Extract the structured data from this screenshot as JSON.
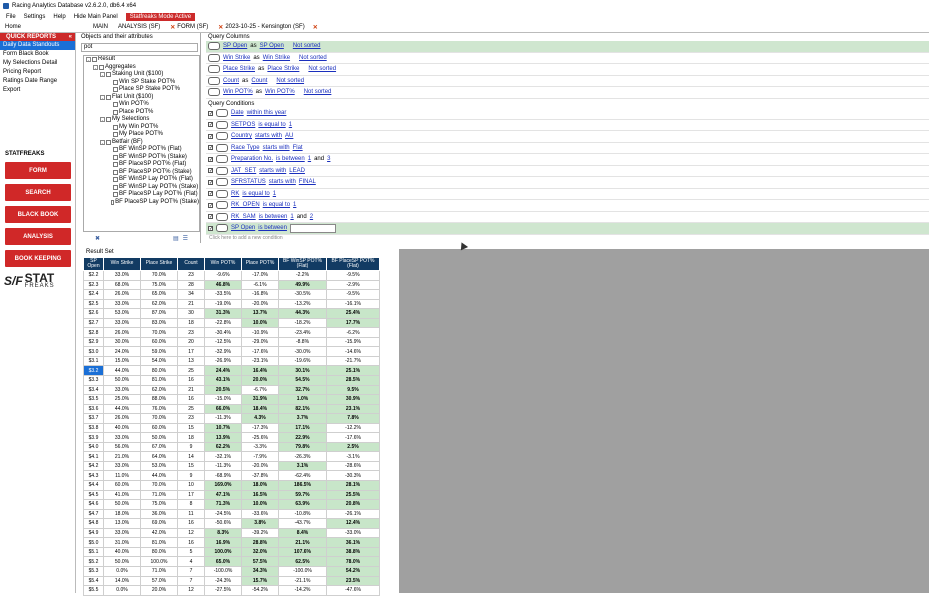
{
  "window": {
    "title": "Racing Analytics Database v2.6.2.0, db6.4 x64"
  },
  "menu": {
    "items": [
      "File",
      "Settings",
      "Help",
      "Hide Main Panel"
    ],
    "mode_badge": "Statfreaks Mode Active"
  },
  "tabs": {
    "home": "Home",
    "main": "MAIN",
    "analysis": "ANALYSIS (SF)",
    "form": "FORM (SF)",
    "meeting": "2023-10-25 - Kensington (SF)"
  },
  "sidebar": {
    "quick_reports_title": "QUICK REPORTS",
    "quick_reports": [
      "Daily Data Standouts",
      "Form Black Book",
      "My Selections Detail",
      "Pricing Report",
      "Ratings Date Range Export"
    ],
    "statfreaks_title": "STATFREAKS",
    "buttons": [
      "FORM",
      "SEARCH",
      "BLACK BOOK",
      "ANALYSIS",
      "BOOK KEEPING"
    ],
    "logo_mark": "S/F",
    "logo_word": "STAT",
    "logo_sub": "FREAKS"
  },
  "objects": {
    "title": "Objects and their attributes",
    "search_value": "pot",
    "tree": [
      {
        "label": "Result",
        "level": 0,
        "expander": "-"
      },
      {
        "label": "Aggregates",
        "level": 1,
        "expander": "-"
      },
      {
        "label": "Staking Unit ($100)",
        "level": 2,
        "expander": "-"
      },
      {
        "label": "Win SP Stake POT%",
        "level": 3,
        "expander": ""
      },
      {
        "label": "Place SP Stake POT%",
        "level": 3,
        "expander": ""
      },
      {
        "label": "Flat Unit ($100)",
        "level": 2,
        "expander": "-"
      },
      {
        "label": "Win POT%",
        "level": 3,
        "expander": ""
      },
      {
        "label": "Place POT%",
        "level": 3,
        "expander": ""
      },
      {
        "label": "My Selections",
        "level": 2,
        "expander": "-"
      },
      {
        "label": "My Win POT%",
        "level": 3,
        "expander": ""
      },
      {
        "label": "My Place POT%",
        "level": 3,
        "expander": ""
      },
      {
        "label": "Betfair (BF)",
        "level": 2,
        "expander": "-"
      },
      {
        "label": "BF WinSP POT% (Flat)",
        "level": 3,
        "expander": ""
      },
      {
        "label": "BF WinSP POT% (Stake)",
        "level": 3,
        "expander": ""
      },
      {
        "label": "BF PlaceSP POT% (Flat)",
        "level": 3,
        "expander": ""
      },
      {
        "label": "BF PlaceSP POT% (Stake)",
        "level": 3,
        "expander": ""
      },
      {
        "label": "BF WinSP Lay POT% (Flat)",
        "level": 3,
        "expander": ""
      },
      {
        "label": "BF WinSP Lay POT% (Stake)",
        "level": 3,
        "expander": ""
      },
      {
        "label": "BF PlaceSP Lay POT% (Flat)",
        "level": 3,
        "expander": ""
      },
      {
        "label": "BF PlaceSP Lay POT% (Stake)",
        "level": 3,
        "expander": ""
      }
    ]
  },
  "query_columns": {
    "title": "Query Columns",
    "rows": [
      {
        "field": "SP Open",
        "as": "as",
        "alias": "SP Open",
        "sort": "Not sorted",
        "highlight": true
      },
      {
        "field": "Win Strike",
        "as": "as",
        "alias": "Win Strike",
        "sort": "Not sorted",
        "highlight": false
      },
      {
        "field": "Place Strike",
        "as": "as",
        "alias": "Place Strike",
        "sort": "Not sorted",
        "highlight": false
      },
      {
        "field": "Count",
        "as": "as",
        "alias": "Count",
        "sort": "Not sorted",
        "highlight": false
      },
      {
        "field": "Win POT%",
        "as": "as",
        "alias": "Win POT%",
        "sort": "Not sorted",
        "highlight": false
      }
    ]
  },
  "query_conditions": {
    "title": "Query Conditions",
    "rows": [
      {
        "field": "Date",
        "op": "within this year",
        "v1": "",
        "and": "",
        "v2": "",
        "highlight": false
      },
      {
        "field": "SETPOS",
        "op": "is equal to",
        "v1": "1",
        "and": "",
        "v2": "",
        "highlight": false
      },
      {
        "field": "Country",
        "op": "starts with",
        "v1": "AU",
        "and": "",
        "v2": "",
        "highlight": false
      },
      {
        "field": "Race Type",
        "op": "starts with",
        "v1": "Flat",
        "and": "",
        "v2": "",
        "highlight": false
      },
      {
        "field": "Preparation No.",
        "op": "is between",
        "v1": "1",
        "and": "and",
        "v2": "3",
        "highlight": false
      },
      {
        "field": "JAT_SET",
        "op": "starts with",
        "v1": "LEAD",
        "and": "",
        "v2": "",
        "highlight": false
      },
      {
        "field": "SFRSTATUS",
        "op": "starts with",
        "v1": "FINAL",
        "and": "",
        "v2": "",
        "highlight": false
      },
      {
        "field": "RK",
        "op": "is equal to",
        "v1": "1",
        "and": "",
        "v2": "",
        "highlight": false
      },
      {
        "field": "RK_OPEN",
        "op": "is equal to",
        "v1": "1",
        "and": "",
        "v2": "",
        "highlight": false
      },
      {
        "field": "RK_SAM",
        "op": "is between",
        "v1": "1",
        "and": "and",
        "v2": "2",
        "highlight": false
      },
      {
        "field": "SP Open",
        "op": "is between",
        "v1": "",
        "and": "",
        "v2": "",
        "highlight": true
      }
    ],
    "add_hint": "Click here to add a new condition"
  },
  "result": {
    "title": "Result Set",
    "headers": [
      "SP Open",
      "Win Strike",
      "Place Strike",
      "Count",
      "Win POT%",
      "Place POT%",
      "BF WinSP POT% (Flat)",
      "BF PlaceSP POT% (Flat)"
    ],
    "selected_row": 10,
    "rows": [
      [
        "$2.2",
        "33.0%",
        "70.0%",
        "23",
        "-9.6%",
        "-17.0%",
        "-2.2%",
        "-9.5%"
      ],
      [
        "$2.3",
        "68.0%",
        "75.0%",
        "28",
        "46.8%",
        "-6.1%",
        "49.9%",
        "-2.9%"
      ],
      [
        "$2.4",
        "26.0%",
        "65.0%",
        "34",
        "-33.5%",
        "-16.8%",
        "-30.5%",
        "-9.5%"
      ],
      [
        "$2.5",
        "33.0%",
        "62.0%",
        "21",
        "-19.0%",
        "-20.0%",
        "-13.2%",
        "-16.1%"
      ],
      [
        "$2.6",
        "53.0%",
        "87.0%",
        "30",
        "31.3%",
        "13.7%",
        "44.3%",
        "25.4%"
      ],
      [
        "$2.7",
        "33.0%",
        "83.0%",
        "18",
        "-22.8%",
        "10.0%",
        "-18.2%",
        "17.7%"
      ],
      [
        "$2.8",
        "26.0%",
        "70.0%",
        "23",
        "-30.4%",
        "-10.9%",
        "-23.4%",
        "-6.2%"
      ],
      [
        "$2.9",
        "30.0%",
        "60.0%",
        "20",
        "-12.5%",
        "-29.0%",
        "-8.8%",
        "-15.9%"
      ],
      [
        "$3.0",
        "24.0%",
        "59.0%",
        "17",
        "-32.9%",
        "-17.6%",
        "-30.0%",
        "-14.6%"
      ],
      [
        "$3.1",
        "15.0%",
        "54.0%",
        "13",
        "-26.9%",
        "-23.1%",
        "-19.6%",
        "-21.7%"
      ],
      [
        "$3.2",
        "44.0%",
        "80.0%",
        "25",
        "24.4%",
        "16.4%",
        "30.1%",
        "25.1%"
      ],
      [
        "$3.3",
        "50.0%",
        "81.0%",
        "16",
        "43.1%",
        "20.0%",
        "54.5%",
        "28.5%"
      ],
      [
        "$3.4",
        "33.0%",
        "62.0%",
        "21",
        "20.5%",
        "-6.7%",
        "32.7%",
        "9.5%"
      ],
      [
        "$3.5",
        "25.0%",
        "88.0%",
        "16",
        "-15.0%",
        "31.9%",
        "1.0%",
        "30.9%"
      ],
      [
        "$3.6",
        "44.0%",
        "76.0%",
        "25",
        "66.0%",
        "18.4%",
        "82.1%",
        "23.1%"
      ],
      [
        "$3.7",
        "26.0%",
        "70.0%",
        "23",
        "-11.3%",
        "4.3%",
        "3.7%",
        "7.8%"
      ],
      [
        "$3.8",
        "40.0%",
        "60.0%",
        "15",
        "10.7%",
        "-17.3%",
        "17.1%",
        "-12.2%"
      ],
      [
        "$3.9",
        "33.0%",
        "50.0%",
        "18",
        "13.9%",
        "-25.6%",
        "22.9%",
        "-17.6%"
      ],
      [
        "$4.0",
        "56.0%",
        "67.0%",
        "9",
        "62.2%",
        "-3.3%",
        "79.8%",
        "2.5%"
      ],
      [
        "$4.1",
        "21.0%",
        "64.0%",
        "14",
        "-32.1%",
        "-7.9%",
        "-26.3%",
        "-3.1%"
      ],
      [
        "$4.2",
        "33.0%",
        "53.0%",
        "15",
        "-11.3%",
        "-20.0%",
        "3.1%",
        "-28.6%"
      ],
      [
        "$4.3",
        "11.0%",
        "44.0%",
        "9",
        "-68.9%",
        "-37.8%",
        "-62.4%",
        "-30.3%"
      ],
      [
        "$4.4",
        "60.0%",
        "70.0%",
        "10",
        "169.0%",
        "18.0%",
        "186.5%",
        "28.1%"
      ],
      [
        "$4.5",
        "41.0%",
        "71.0%",
        "17",
        "47.1%",
        "16.5%",
        "59.7%",
        "25.5%"
      ],
      [
        "$4.6",
        "50.0%",
        "75.0%",
        "8",
        "71.3%",
        "10.0%",
        "63.9%",
        "20.8%"
      ],
      [
        "$4.7",
        "18.0%",
        "36.0%",
        "11",
        "-24.5%",
        "-33.6%",
        "-10.8%",
        "-26.1%"
      ],
      [
        "$4.8",
        "13.0%",
        "69.0%",
        "16",
        "-50.6%",
        "3.8%",
        "-43.7%",
        "12.4%"
      ],
      [
        "$4.9",
        "33.0%",
        "42.0%",
        "12",
        "8.3%",
        "-39.2%",
        "8.4%",
        "-33.0%"
      ],
      [
        "$5.0",
        "31.0%",
        "81.0%",
        "16",
        "16.9%",
        "28.8%",
        "21.1%",
        "36.1%"
      ],
      [
        "$5.1",
        "40.0%",
        "80.0%",
        "5",
        "100.0%",
        "32.0%",
        "107.6%",
        "38.8%"
      ],
      [
        "$5.2",
        "50.0%",
        "100.0%",
        "4",
        "65.0%",
        "57.5%",
        "62.5%",
        "78.0%"
      ],
      [
        "$5.3",
        "0.0%",
        "71.0%",
        "7",
        "-100.0%",
        "34.3%",
        "-100.0%",
        "54.2%"
      ],
      [
        "$5.4",
        "14.0%",
        "57.0%",
        "7",
        "-24.3%",
        "15.7%",
        "-21.1%",
        "23.5%"
      ],
      [
        "$5.5",
        "0.0%",
        "20.0%",
        "12",
        "-27.5%",
        "-54.2%",
        "-14.2%",
        "-47.6%"
      ]
    ]
  },
  "colors": {
    "accent_red": "#d02828",
    "header_navy": "#123b63",
    "positive_green": "#c8e6c9",
    "select_blue": "#1a6fd6"
  }
}
